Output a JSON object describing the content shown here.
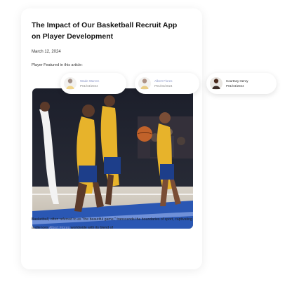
{
  "article": {
    "title": "The Impact of Our Basketball Recruit App on Player Development",
    "date": "March 12, 2024",
    "featured_label": "Player Featured in this article:",
    "body_part1": "Basketball, often referred to as \"the beautiful game,\" transcends the boundaries of sport, captivating audiences ",
    "body_link": "Albert Flores",
    "body_part2": " worldwide with its blend of"
  },
  "players": [
    {
      "name": "Wade Warren",
      "date": "P01/04/2024",
      "state": "faded"
    },
    {
      "name": "Albert Flores",
      "date": "P01/04/2024",
      "state": "faded"
    },
    {
      "name": "Courtney Henry",
      "date": "P01/04/2024",
      "state": "active"
    }
  ],
  "colors": {
    "link": "#8a96c8",
    "jersey": "#e7b32b",
    "court": "#2a57b3"
  },
  "icons": [
    "player-avatar-icon"
  ]
}
